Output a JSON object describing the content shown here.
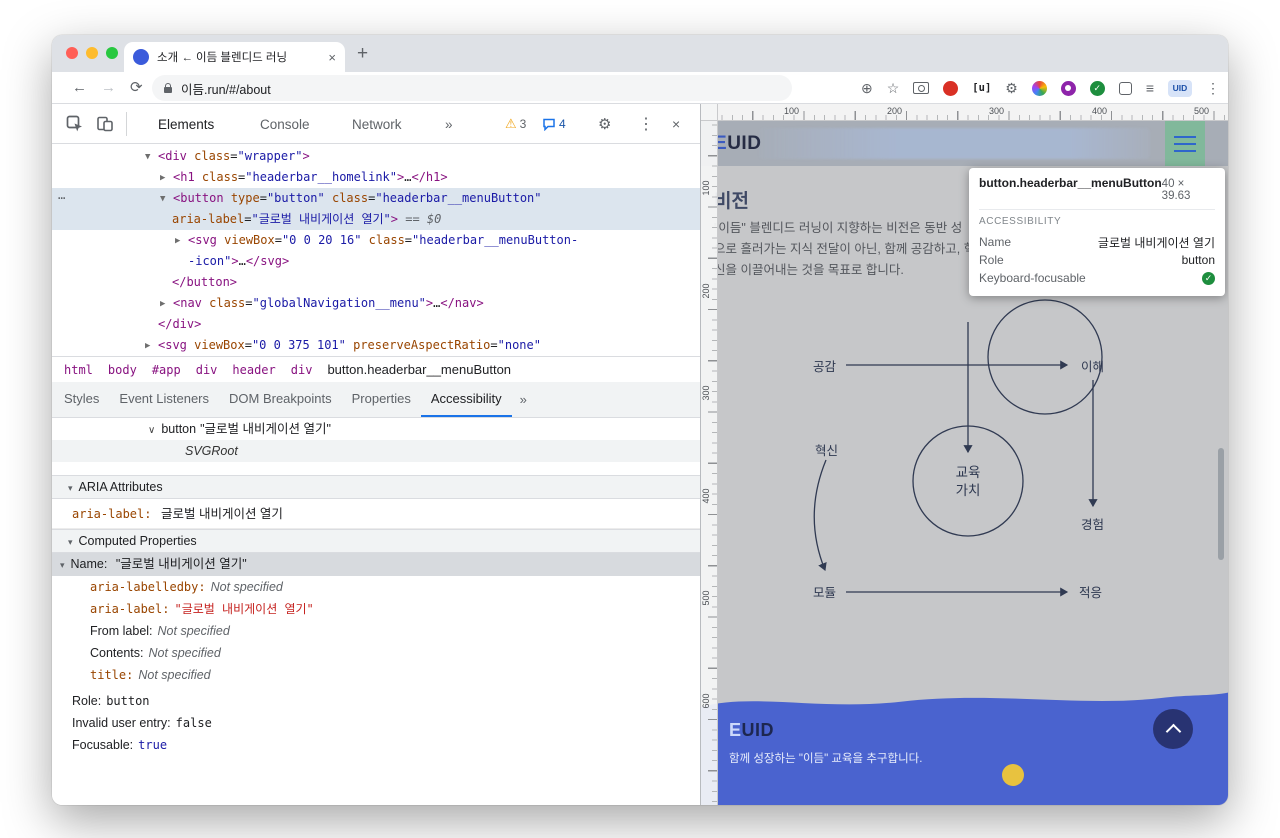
{
  "icons": {
    "close": "×",
    "plus": "+",
    "back": "←",
    "forward": "→",
    "reload": "⟳",
    "kebab": "⋮",
    "gear": "⚙",
    "warning": "⚠",
    "more": "»",
    "chevron_down": "∨",
    "triangle": "▾",
    "star": "☆",
    "crosshair": "⊕",
    "lines": "≡",
    "check": "✓",
    "bracket_u": "[u]",
    "ellipsis": "⋯"
  },
  "browser": {
    "tab_title": "소개 ← 이듬 블렌디드 러닝",
    "url": "이듬.run/#/about",
    "profile": "UID"
  },
  "devtools": {
    "tabs": [
      "Elements",
      "Console",
      "Network"
    ],
    "warning_count": "3",
    "message_count": "4",
    "tree": {
      "gutter": "⋯",
      "lines": [
        [
          [
            "ar",
            "▼"
          ],
          [
            "t",
            "<div"
          ],
          [
            "x",
            " "
          ],
          [
            "a",
            "class"
          ],
          [
            "x",
            "="
          ],
          [
            "v",
            "\"wrapper\""
          ],
          [
            "t",
            ">"
          ]
        ],
        [
          [
            "ar",
            "▶"
          ],
          [
            "t",
            "<h1"
          ],
          [
            "x",
            " "
          ],
          [
            "a",
            "class"
          ],
          [
            "x",
            "="
          ],
          [
            "v",
            "\"headerbar__homelink\""
          ],
          [
            "t",
            ">"
          ],
          [
            "x",
            "…"
          ],
          [
            "t",
            "</h1>"
          ]
        ],
        [
          [
            "ar",
            "▼"
          ],
          [
            "t",
            "<button"
          ],
          [
            "x",
            " "
          ],
          [
            "a",
            "type"
          ],
          [
            "x",
            "="
          ],
          [
            "v",
            "\"button\""
          ],
          [
            "x",
            " "
          ],
          [
            "a",
            "class"
          ],
          [
            "x",
            "="
          ],
          [
            "v",
            "\"headerbar__menuButton\""
          ]
        ],
        [
          [
            "a",
            "aria-label"
          ],
          [
            "x",
            "="
          ],
          [
            "v",
            "\"글로벌 내비게이션 열기\""
          ],
          [
            "t",
            ">"
          ],
          [
            "d",
            " == $0"
          ]
        ],
        [
          [
            "ar",
            "▶"
          ],
          [
            "t",
            "<svg"
          ],
          [
            "x",
            " "
          ],
          [
            "a",
            "viewBox"
          ],
          [
            "x",
            "="
          ],
          [
            "v",
            "\"0 0 20 16\""
          ],
          [
            "x",
            " "
          ],
          [
            "a",
            "class"
          ],
          [
            "x",
            "="
          ],
          [
            "v",
            "\"headerbar__menuButton-"
          ]
        ],
        [
          [
            "v",
            "-icon\""
          ],
          [
            "t",
            ">"
          ],
          [
            "x",
            "…"
          ],
          [
            "t",
            "</svg>"
          ]
        ],
        [
          [
            "t",
            "</button>"
          ]
        ],
        [
          [
            "ar",
            "▶"
          ],
          [
            "t",
            "<nav"
          ],
          [
            "x",
            " "
          ],
          [
            "a",
            "class"
          ],
          [
            "x",
            "="
          ],
          [
            "v",
            "\"globalNavigation__menu\""
          ],
          [
            "t",
            ">"
          ],
          [
            "x",
            "…"
          ],
          [
            "t",
            "</nav>"
          ]
        ],
        [
          [
            "t",
            "</div>"
          ]
        ],
        [
          [
            "ar",
            "▶"
          ],
          [
            "t",
            "<svg"
          ],
          [
            "x",
            " "
          ],
          [
            "a",
            "viewBox"
          ],
          [
            "x",
            "="
          ],
          [
            "v",
            "\"0 0 375 101\""
          ],
          [
            "x",
            " "
          ],
          [
            "a",
            "preserveAspectRatio"
          ],
          [
            "x",
            "="
          ],
          [
            "v",
            "\"none\""
          ]
        ]
      ]
    },
    "breadcrumbs": [
      "html",
      "body",
      "#app",
      "div",
      "header",
      "div",
      "button.headerbar__menuButton"
    ],
    "side_tabs": [
      "Styles",
      "Event Listeners",
      "DOM Breakpoints",
      "Properties",
      "Accessibility"
    ],
    "a11y": {
      "node_role": "button",
      "node_name": "\"글로벌 내비게이션 열기\"",
      "svg_root": "SVGRoot",
      "aria_section": "ARIA Attributes",
      "aria_label_key": "aria-label:",
      "aria_label_value": "글로벌 내비게이션 열기",
      "computed_section": "Computed Properties",
      "name_label": "Name:",
      "name_value": "\"글로벌 내비게이션 열기\"",
      "rows": {
        "labelledby": {
          "k": "aria-labelledby:",
          "v": "Not specified"
        },
        "arialabel": {
          "k": "aria-label:",
          "v": "\"글로벌 내비게이션 열기\""
        },
        "fromlabel": {
          "k": "From label:",
          "v": "Not specified"
        },
        "contents": {
          "k": "Contents:",
          "v": "Not specified"
        },
        "title": {
          "k": "title:",
          "v": "Not specified"
        }
      },
      "role_label": "Role:",
      "role_value": "button",
      "invalid_label": "Invalid user entry:",
      "invalid_value": "false",
      "focusable_label": "Focusable:",
      "focusable_value": "true"
    }
  },
  "page": {
    "logo_e": "E",
    "logo_rest": "UID",
    "rulers": {
      "h": [
        "100",
        "200",
        "300",
        "400",
        "500"
      ],
      "v": [
        "100",
        "200",
        "300",
        "400",
        "500",
        "600"
      ]
    },
    "tooltip": {
      "element": "button.headerbar__menuButton",
      "size": "40 × 39.63",
      "section": "ACCESSIBILITY",
      "name_label": "Name",
      "name_value": "글로벌 내비게이션 열기",
      "role_label": "Role",
      "role_value": "button",
      "focus_label": "Keyboard-focusable"
    },
    "vision_title": "비전",
    "vision_lines": [
      "\"이듬\" 블렌디드 러닝이 지향하는 비전은 동반 성",
      "으로 흘러가는 지식 전달이 아닌, 함께 공감하고, 혁",
      "신을 이끌어내는 것을 목표로 합니다."
    ],
    "diagram": {
      "top_left": "공감",
      "top_right": "이해",
      "mid_left": "혁신",
      "center1": "교육",
      "center2": "가치",
      "mid_right": "경험",
      "bottom_left": "모듈",
      "bottom_right": "적응"
    },
    "footer": {
      "logo_e": "E",
      "logo_rest": "UID",
      "tagline": "함께 성장하는 \"이듬\" 교육을 추구합니다."
    }
  }
}
